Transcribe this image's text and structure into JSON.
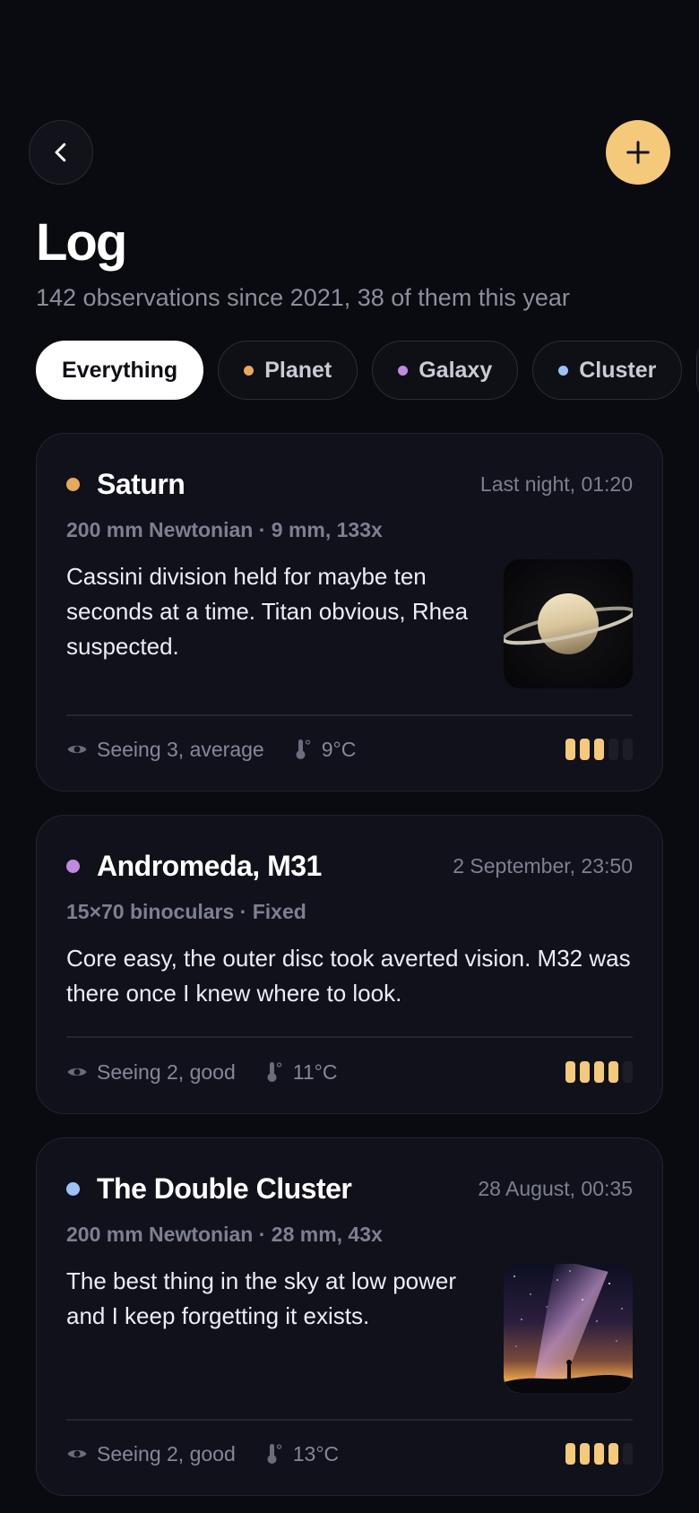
{
  "header": {
    "title": "Log",
    "subtitle": "142 observations since 2021, 38 of them this year"
  },
  "filters": [
    {
      "label": "Everything",
      "active": true,
      "color": null
    },
    {
      "label": "Planet",
      "active": false,
      "color": "#e8a95a"
    },
    {
      "label": "Galaxy",
      "active": false,
      "color": "#c08ae0"
    },
    {
      "label": "Cluster",
      "active": false,
      "color": "#9cc3f5"
    }
  ],
  "observations": [
    {
      "title": "Saturn",
      "category_color": "#e8a95a",
      "time": "Last night, 01:20",
      "gear": "200 mm Newtonian · 9 mm, 133x",
      "note": "Cassini division held for maybe ten seconds at a time. Titan obvious, Rhea suspected.",
      "photo": "saturn",
      "seeing": "Seeing 3, average",
      "temp": "9°C",
      "rating": 3,
      "rating_max": 5
    },
    {
      "title": "Andromeda, M31",
      "category_color": "#c08ae0",
      "time": "2 September, 23:50",
      "gear": "15×70 binoculars · Fixed",
      "note": "Core easy, the outer disc took averted vision. M32 was there once I knew where to look.",
      "photo": null,
      "seeing": "Seeing 2, good",
      "temp": "11°C",
      "rating": 4,
      "rating_max": 5
    },
    {
      "title": "The Double Cluster",
      "category_color": "#9cc3f5",
      "time": "28 August, 00:35",
      "gear": "200 mm Newtonian · 28 mm, 43x",
      "note": "The best thing in the sky at low power and I keep forgetting it exists.",
      "photo": "milky-way",
      "seeing": "Seeing 2, good",
      "temp": "13°C",
      "rating": 4,
      "rating_max": 5
    }
  ],
  "colors": {
    "accent": "#f5c97a",
    "background": "#0a0b10",
    "card": "#10111a"
  },
  "icons": {
    "back": "chevron-left-icon",
    "add": "plus-icon",
    "seeing": "eye-icon",
    "temperature": "thermometer-icon"
  }
}
